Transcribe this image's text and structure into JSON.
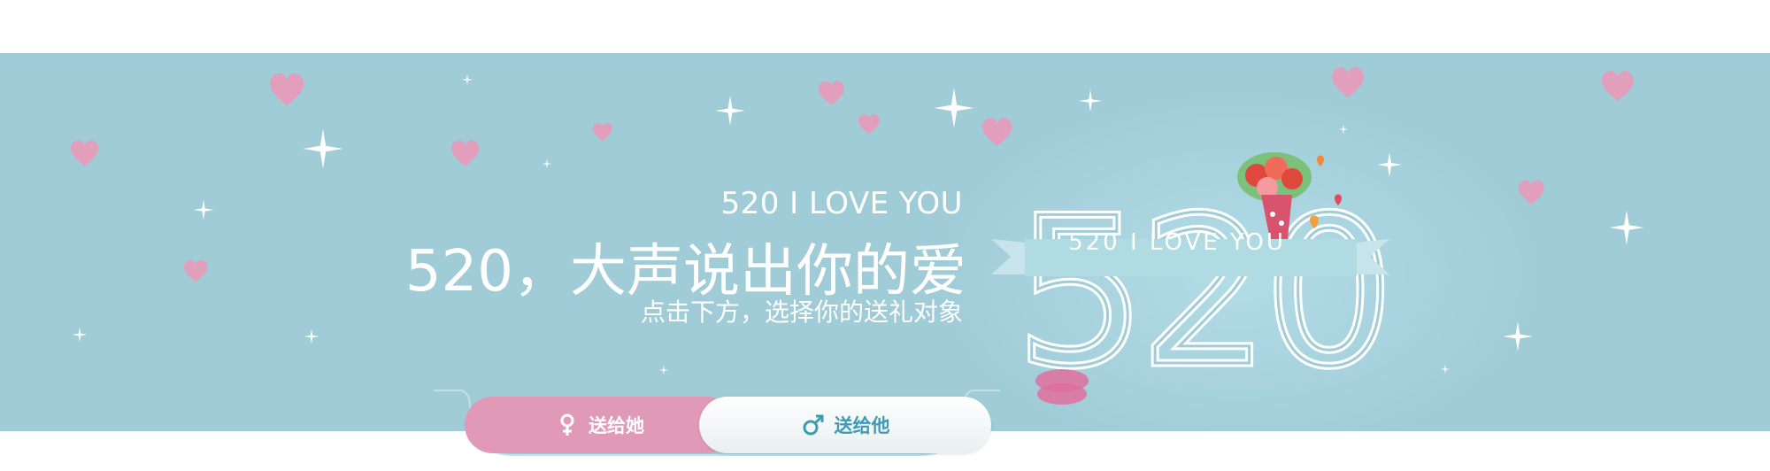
{
  "banner": {
    "subtitle_en": "520 I LOVE YOU",
    "title_cn": "520，大声说出你的爱",
    "subtitle_cn": "点击下方，选择你的送礼对象",
    "big_number": "520",
    "ribbon_text": "520 I LOVE YOU",
    "colors": {
      "background": "#a0ccd8",
      "heart": "#e99ab9",
      "her_tab": "#e09ab8",
      "him_text": "#3f9bb5"
    }
  },
  "tabs": [
    {
      "label": "送给她",
      "icon": "female-symbol-icon",
      "active": true
    },
    {
      "label": "送给他",
      "icon": "male-symbol-icon",
      "active": false
    }
  ]
}
